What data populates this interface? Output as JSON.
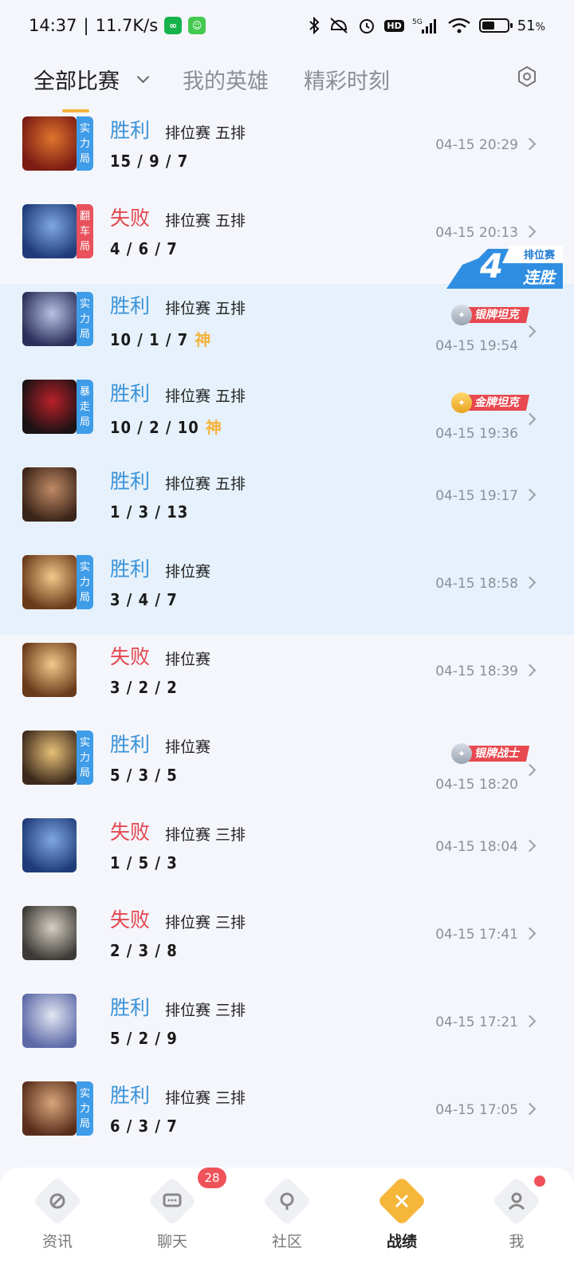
{
  "status_bar": {
    "time": "14:37",
    "speed": "11.7K/s",
    "battery_text": "51",
    "battery_percent_sign": "%",
    "battery_level": 0.51,
    "network": "5G",
    "hd": "HD"
  },
  "tabs": {
    "all": "全部比赛",
    "heroes": "我的英雄",
    "highlights": "精彩时刻"
  },
  "streak": {
    "mode": "排位赛",
    "count": "4",
    "label": "连胜"
  },
  "matches": [
    {
      "result": "胜利",
      "outcome": "win",
      "mode": "排位赛 五排",
      "kda": "15 / 9 / 7",
      "mvp": "",
      "time": "04-15 20:29",
      "tag": [
        "实",
        "力",
        "局"
      ],
      "tag_color": "blue",
      "badge": null,
      "hero_colors": [
        "#7a1c14",
        "#e0742e"
      ]
    },
    {
      "result": "失败",
      "outcome": "lose",
      "mode": "排位赛 五排",
      "kda": "4 / 6 / 7",
      "mvp": "",
      "time": "04-15 20:13",
      "tag": [
        "翻",
        "车",
        "局"
      ],
      "tag_color": "red",
      "badge": null,
      "hero_colors": [
        "#1f3b78",
        "#7fa8e0"
      ]
    },
    {
      "result": "胜利",
      "outcome": "win",
      "mode": "排位赛 五排",
      "kda": "10 / 1 / 7",
      "mvp": "神",
      "time": "04-15 19:54",
      "tag": [
        "实",
        "力",
        "局"
      ],
      "tag_color": "blue",
      "badge": {
        "medal": "silver",
        "text": "银牌坦克"
      },
      "hero_colors": [
        "#2b2f5a",
        "#b7c3e3"
      ]
    },
    {
      "result": "胜利",
      "outcome": "win",
      "mode": "排位赛 五排",
      "kda": "10 / 2 / 10",
      "mvp": "神",
      "time": "04-15 19:36",
      "tag": [
        "暴",
        "走",
        "局"
      ],
      "tag_color": "blue",
      "badge": {
        "medal": "gold",
        "text": "金牌坦克"
      },
      "hero_colors": [
        "#1a1214",
        "#b8202a"
      ]
    },
    {
      "result": "胜利",
      "outcome": "win",
      "mode": "排位赛 五排",
      "kda": "1 / 3 / 13",
      "mvp": "",
      "time": "04-15 19:17",
      "tag": [],
      "tag_color": "",
      "badge": null,
      "hero_colors": [
        "#3b2418",
        "#c08a66"
      ]
    },
    {
      "result": "胜利",
      "outcome": "win",
      "mode": "排位赛",
      "kda": "3 / 4 / 7",
      "mvp": "",
      "time": "04-15 18:58",
      "tag": [
        "实",
        "力",
        "局"
      ],
      "tag_color": "blue",
      "badge": null,
      "hero_colors": [
        "#6b3a1a",
        "#f2c98a"
      ]
    },
    {
      "result": "失败",
      "outcome": "lose",
      "mode": "排位赛",
      "kda": "3 / 2 / 2",
      "mvp": "",
      "time": "04-15 18:39",
      "tag": [],
      "tag_color": "",
      "badge": null,
      "hero_colors": [
        "#6b3a1a",
        "#f2c98a"
      ]
    },
    {
      "result": "胜利",
      "outcome": "win",
      "mode": "排位赛",
      "kda": "5 / 3 / 5",
      "mvp": "",
      "time": "04-15 18:20",
      "tag": [
        "实",
        "力",
        "局"
      ],
      "tag_color": "blue",
      "badge": {
        "medal": "silver",
        "text": "银牌战士"
      },
      "hero_colors": [
        "#3d2a1c",
        "#e8c178"
      ]
    },
    {
      "result": "失败",
      "outcome": "lose",
      "mode": "排位赛 三排",
      "kda": "1 / 5 / 3",
      "mvp": "",
      "time": "04-15 18:04",
      "tag": [],
      "tag_color": "",
      "badge": null,
      "hero_colors": [
        "#1f3b78",
        "#7fa8e0"
      ]
    },
    {
      "result": "失败",
      "outcome": "lose",
      "mode": "排位赛 三排",
      "kda": "2 / 3 / 8",
      "mvp": "",
      "time": "04-15 17:41",
      "tag": [],
      "tag_color": "",
      "badge": null,
      "hero_colors": [
        "#3c3a36",
        "#d6d0c4"
      ]
    },
    {
      "result": "胜利",
      "outcome": "win",
      "mode": "排位赛 三排",
      "kda": "5 / 2 / 9",
      "mvp": "",
      "time": "04-15 17:21",
      "tag": [],
      "tag_color": "",
      "badge": null,
      "hero_colors": [
        "#5d6aa8",
        "#e3e6f2"
      ]
    },
    {
      "result": "胜利",
      "outcome": "win",
      "mode": "排位赛 三排",
      "kda": "6 / 3 / 7",
      "mvp": "",
      "time": "04-15 17:05",
      "tag": [
        "实",
        "力",
        "局"
      ],
      "tag_color": "blue",
      "badge": null,
      "hero_colors": [
        "#5a2e1c",
        "#d9a57a"
      ]
    }
  ],
  "nav": [
    {
      "label": "资讯",
      "icon": "news-icon",
      "badge": "",
      "dot": false,
      "active": false
    },
    {
      "label": "聊天",
      "icon": "chat-icon",
      "badge": "28",
      "dot": false,
      "active": false
    },
    {
      "label": "社区",
      "icon": "community-icon",
      "badge": "",
      "dot": false,
      "active": false
    },
    {
      "label": "战绩",
      "icon": "record-icon",
      "badge": "",
      "dot": false,
      "active": true
    },
    {
      "label": "我",
      "icon": "profile-icon",
      "badge": "",
      "dot": true,
      "active": false
    }
  ]
}
